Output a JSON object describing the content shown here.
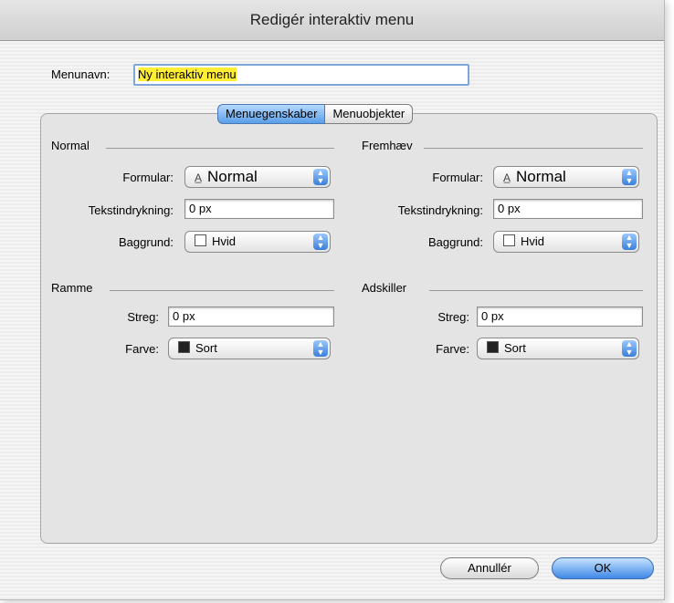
{
  "window": {
    "title": "Redigér interaktiv menu"
  },
  "menu_name": {
    "label": "Menunavn:",
    "value": "Ny interaktiv menu"
  },
  "tabs": [
    {
      "label": "Menuegenskaber",
      "active": true
    },
    {
      "label": "Menuobjekter",
      "active": false
    }
  ],
  "normal": {
    "title": "Normal",
    "formular_label": "Formular:",
    "formular_value": "Normal",
    "indent_label": "Tekstindrykning:",
    "indent_value": "0 px",
    "bg_label": "Baggrund:",
    "bg_value": "Hvid"
  },
  "highlight": {
    "title": "Fremhæv",
    "formular_label": "Formular:",
    "formular_value": "Normal",
    "indent_label": "Tekstindrykning:",
    "indent_value": "0 px",
    "bg_label": "Baggrund:",
    "bg_value": "Hvid"
  },
  "frame": {
    "title": "Ramme",
    "stroke_label": "Streg:",
    "stroke_value": "0 px",
    "color_label": "Farve:",
    "color_value": "Sort"
  },
  "separator": {
    "title": "Adskiller",
    "stroke_label": "Streg:",
    "stroke_value": "0 px",
    "color_label": "Farve:",
    "color_value": "Sort"
  },
  "buttons": {
    "cancel": "Annullér",
    "ok": "OK"
  },
  "colors": {
    "white_swatch": "#ffffff",
    "black_swatch": "#222222",
    "highlight": "#ffee33",
    "accent": "#3f88e6"
  },
  "icons": {
    "font_glyph": "A̲"
  }
}
